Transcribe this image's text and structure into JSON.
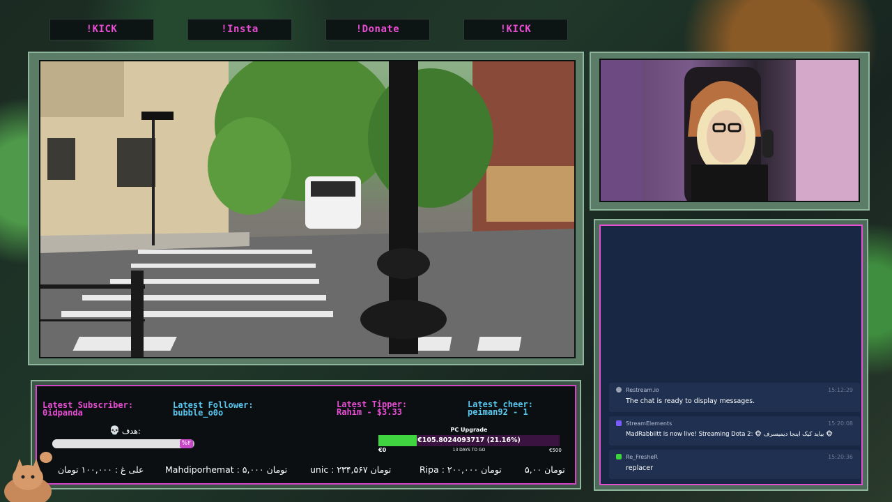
{
  "commands": [
    "!KICK",
    "!Insta",
    "!Donate",
    "!KICK"
  ],
  "stats": {
    "subscriber_label": "Latest Subscriber:",
    "subscriber_value": "0idpanda",
    "follower_label": "Latest Follower:",
    "follower_value": "bubble_o0o",
    "tipper_label": "Latest Tipper:",
    "tipper_value": "Rahim - $3.33",
    "cheer_label": "Latest cheer:",
    "cheer_value": "peiman92 - 1"
  },
  "goal": {
    "label": "هدف:",
    "percent_text": "%۲",
    "progress": 0.93
  },
  "pc_goal": {
    "title": "PC Upgrade",
    "amount_text": "€105.8024093717 (21.16%)",
    "progress": 0.2116,
    "min": "€0",
    "max": "€500",
    "days_left": "13 DAYS TO GO"
  },
  "ticker": [
    "علی غ : ۱۰۰,۰۰۰ تومان",
    "Mahdiporhemat : ۵,۰۰۰ تومان",
    "unic : ۲۳۴,۵۶۷ تومان",
    "Ripa : ۲۰۰,۰۰۰ تومان",
    "۵,۰۰ تومان"
  ],
  "chat": {
    "messages": [
      {
        "user": "Restream.io",
        "time": "15:12:29",
        "text": "The chat is ready to display messages.",
        "color": "#9aa3b5"
      },
      {
        "user": "StreamElements",
        "time": "15:20:08",
        "text": "MadRabbiitt is now live! Streaming Dota 2: 🐵 بیاید کیک اینجا دیمیسرف 🐵",
        "color": "#7a5cff"
      },
      {
        "user": "Re_FresheR",
        "time": "15:20:36",
        "text": "replacer",
        "color": "#3bd43b"
      }
    ]
  },
  "colors": {
    "accent_pink": "#e84dd4",
    "accent_cyan": "#59c8f0",
    "chat_bg": "#182743"
  }
}
